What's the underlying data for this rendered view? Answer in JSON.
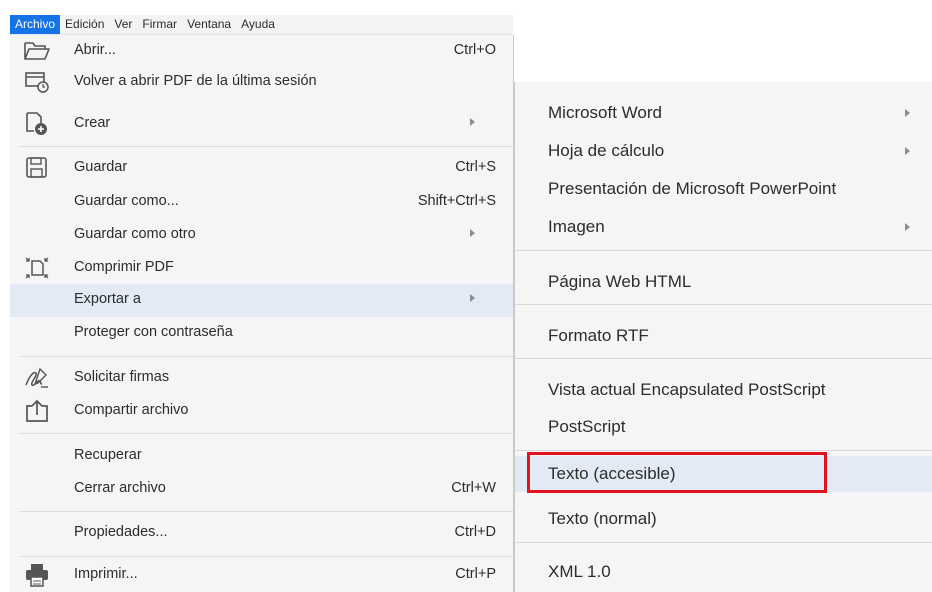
{
  "menubar": {
    "items": [
      "Archivo",
      "Edición",
      "Ver",
      "Firmar",
      "Ventana",
      "Ayuda"
    ]
  },
  "file_menu": {
    "items": [
      {
        "label": "Abrir...",
        "shortcut": "Ctrl+O",
        "icon": "folder-open-icon"
      },
      {
        "label": "Volver a abrir PDF de la última sesión",
        "icon": "reopen-session-icon"
      },
      {
        "label": "Crear",
        "submenu": true,
        "icon": "create-pdf-icon"
      },
      {
        "label": "Guardar",
        "shortcut": "Ctrl+S",
        "icon": "save-icon"
      },
      {
        "label": "Guardar como...",
        "shortcut": "Shift+Ctrl+S"
      },
      {
        "label": "Guardar como otro",
        "submenu": true
      },
      {
        "label": "Comprimir PDF",
        "icon": "compress-pdf-icon"
      },
      {
        "label": "Exportar a",
        "submenu": true,
        "highlighted": true
      },
      {
        "label": "Proteger con contraseña"
      },
      {
        "label": "Solicitar firmas",
        "icon": "signature-icon"
      },
      {
        "label": "Compartir archivo",
        "icon": "share-icon"
      },
      {
        "label": "Recuperar"
      },
      {
        "label": "Cerrar archivo",
        "shortcut": "Ctrl+W"
      },
      {
        "label": "Propiedades...",
        "shortcut": "Ctrl+D"
      },
      {
        "label": "Imprimir...",
        "shortcut": "Ctrl+P",
        "icon": "printer-icon"
      }
    ]
  },
  "export_submenu": {
    "items": [
      {
        "label": "Microsoft Word",
        "submenu": true
      },
      {
        "label": "Hoja de cálculo",
        "submenu": true
      },
      {
        "label": "Presentación de Microsoft PowerPoint"
      },
      {
        "label": "Imagen",
        "submenu": true
      },
      {
        "label": "Página Web HTML"
      },
      {
        "label": "Formato RTF"
      },
      {
        "label": "Vista actual Encapsulated PostScript"
      },
      {
        "label": "PostScript"
      },
      {
        "label": "Texto (accesible)",
        "highlighted": true,
        "annotated": true
      },
      {
        "label": "Texto (normal)"
      },
      {
        "label": "XML 1.0"
      }
    ]
  },
  "colors": {
    "accent": "#1473e6",
    "menu_bg": "#f5f5f5",
    "hover_bg": "#e2eaf6",
    "annotation": "#e0141e"
  }
}
